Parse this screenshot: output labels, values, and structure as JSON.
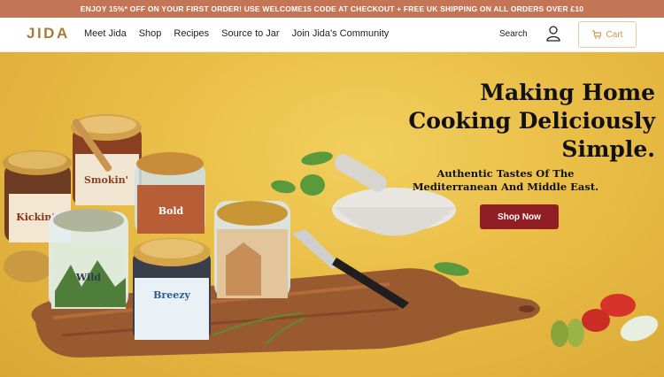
{
  "promo": {
    "text": "ENJOY 15%* OFF ON YOUR FIRST ORDER! USE WELCOME15 CODE AT CHECKOUT + FREE UK SHIPPING ON ALL ORDERS OVER £10"
  },
  "header": {
    "logo": "JIDA",
    "nav": [
      "Meet Jida",
      "Shop",
      "Recipes",
      "Source to Jar",
      "Join Jida's Community"
    ],
    "search_label": "Search",
    "cart_label": "Cart"
  },
  "hero": {
    "title_line1": "Making Home",
    "title_line2": "Cooking Deliciously",
    "title_line3": "Simple.",
    "subtitle_line1": "Authentic Tastes Of The",
    "subtitle_line2": "Mediterranean And Middle East.",
    "cta": "Shop Now",
    "jar_labels": [
      "Kickin'",
      "Smokin'",
      "Bold",
      "Wild",
      "Breezy"
    ]
  },
  "colors": {
    "promo_bg": "#c47556",
    "brand_gold": "#a87b3c",
    "cta_bg": "#8f1f24",
    "hero_bg": "#e9bd45"
  }
}
